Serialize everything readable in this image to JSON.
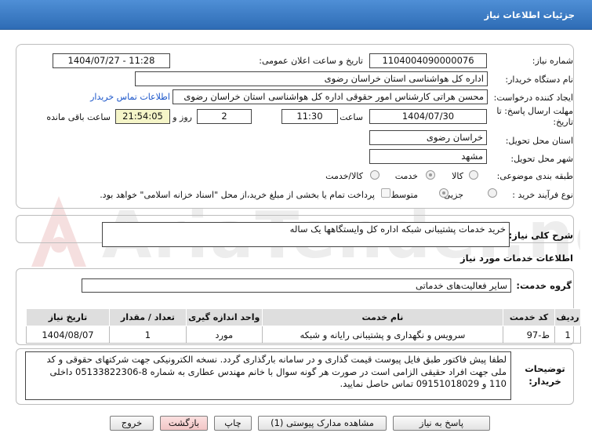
{
  "title": "جزئیات اطلاعات نیاز",
  "watermark": "AriaTender.net",
  "form": {
    "need_number_label": "شماره نیاز:",
    "need_number": "1104004090000076",
    "announce_label": "تاریخ و ساعت اعلان عمومی:",
    "announce_value": "1404/07/27 - 11:28",
    "buyer_org_label": "نام دستگاه خریدار:",
    "buyer_org": "اداره کل هواشناسی استان خراسان رضوی",
    "creator_label": "ایجاد کننده درخواست:",
    "creator": "محسن هراتی کارشناس امور حقوقی اداره کل هواشناسی استان خراسان رضوی",
    "contact_link": "اطلاعات تماس خریدار",
    "deadline_label": "مهلت ارسال پاسخ: تا تاریخ:",
    "deadline_date": "1404/07/30",
    "time_label": "ساعت",
    "deadline_time": "11:30",
    "days": "2",
    "days_label": "روز و",
    "remaining_time": "21:54:05",
    "remaining_label": "ساعت باقی مانده",
    "province_label": "استان محل تحویل:",
    "province": "خراسان رضوی",
    "city_label": "شهر محل تحویل:",
    "city": "مشهد",
    "category_label": "طبقه بندی موضوعی:",
    "category_options": [
      "کالا",
      "خدمت",
      "کالا/خدمت"
    ],
    "purchase_type_label": "نوع فرآیند خرید :",
    "purchase_options": [
      "جزیی",
      "متوسط"
    ],
    "payment_note": "پرداخت تمام یا بخشی از مبلغ خرید،از محل \"اسناد خزانه اسلامی\" خواهد بود."
  },
  "summary": {
    "label": "شرح کلی نیاز:",
    "value": "خرید خدمات پشتیبانی شبکه اداره کل وایستگاهها یک ساله"
  },
  "services": {
    "heading": "اطلاعات خدمات مورد نیاز",
    "group_label": "گروه خدمت:",
    "group_value": "سایر فعالیت‌های خدماتی",
    "columns": [
      "ردیف",
      "کد خدمت",
      "نام خدمت",
      "واحد اندازه گیری",
      "تعداد / مقدار",
      "تاریخ نیاز"
    ],
    "rows": [
      [
        "1",
        "ط-97",
        "سرویس و نگهداری و پشتیبانی رایانه و شبکه",
        "مورد",
        "1",
        "1404/08/07"
      ]
    ]
  },
  "notes": {
    "label": "توضیحات خریدار:",
    "text": "لطفا پیش فاکتور طبق فایل پیوست قیمت گذاری  و در سامانه بارگذاری گردد. نسخه الکترونیکی جهت شرکتهای حقوقی و کد ملی جهت افراد حقیقی الزامی است در صورت هر گونه سوال با خانم مهندس عطاری به شماره 8-05133822306 داخلی 110 و 09151018029 تماس حاصل نمایید."
  },
  "buttons": {
    "reply": "پاسخ به نیاز",
    "attachments": "مشاهده مدارک پیوستی (1)",
    "print": "چاپ",
    "back": "بازگشت",
    "exit": "خروج"
  },
  "colors": {
    "header": "#3a78c2",
    "accent": "#1a55c9",
    "remaining_bg": "#f5f5c8"
  }
}
